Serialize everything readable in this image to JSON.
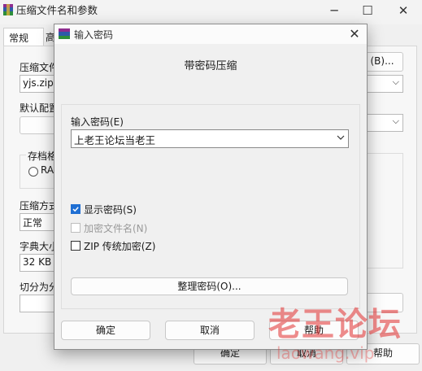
{
  "background_window": {
    "title": "压缩文件名和参数",
    "tabs": [
      "常规",
      "高"
    ],
    "archive_label": "压缩文件",
    "archive_value": "yjs.zip",
    "browse_label": "(B)...",
    "default_config_label": "默认配置",
    "format_group_label": "存档格",
    "format_option": "RA",
    "method_label": "压缩方式",
    "method_value": "正常",
    "dict_label": "字典大小",
    "dict_value": "32 KB",
    "split_label": "切分为分",
    "ok_label": "确定",
    "cancel_label": "取消",
    "help_label": "帮助"
  },
  "dialog": {
    "title": "输入密码",
    "heading": "带密码压缩",
    "password_label": "输入密码(E)",
    "password_value": "上老王论坛当老王",
    "show_password_label": "显示密码(S)",
    "show_password_checked": true,
    "encrypt_filenames_label": "加密文件名(N)",
    "encrypt_filenames_checked": false,
    "encrypt_filenames_enabled": false,
    "zip_legacy_label": "ZIP 传统加密(Z)",
    "zip_legacy_checked": false,
    "organize_button": "整理密码(O)...",
    "ok_button": "确定",
    "cancel_button": "取消",
    "help_button": "帮助"
  },
  "watermark": {
    "text": "老王论坛",
    "url": "laowang.vip"
  }
}
